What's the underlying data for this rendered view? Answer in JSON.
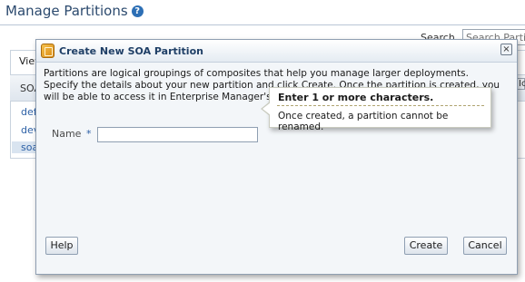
{
  "page": {
    "title": "Manage Partitions",
    "help_icon_glyph": "?",
    "search_label": "Search",
    "search_placeholder": "Search Partiti",
    "view_menu": "View",
    "column_header": "SOA",
    "column_header_right": "Ic",
    "rows": [
      "def",
      "dev",
      "soa"
    ]
  },
  "dialog": {
    "title": "Create New SOA Partition",
    "icon": "partition-icon",
    "close_glyph": "×",
    "description": "Partitions are logical groupings of composites that help you manage larger deployments. Specify the details about your new partition and click Create. Once the partition is created, you will be able to access it in Enterprise Manager's navigation tree.",
    "name_label": "Name",
    "required_mark": "*",
    "name_value": "",
    "hint": {
      "title": "Enter 1 or more characters.",
      "text": "Once created, a partition cannot be renamed."
    },
    "buttons": {
      "help": "Help",
      "create": "Create",
      "cancel": "Cancel"
    }
  },
  "colors": {
    "title": "#2c4a6e",
    "link": "#2b5fa5",
    "dialog_title": "#1f3f66"
  }
}
